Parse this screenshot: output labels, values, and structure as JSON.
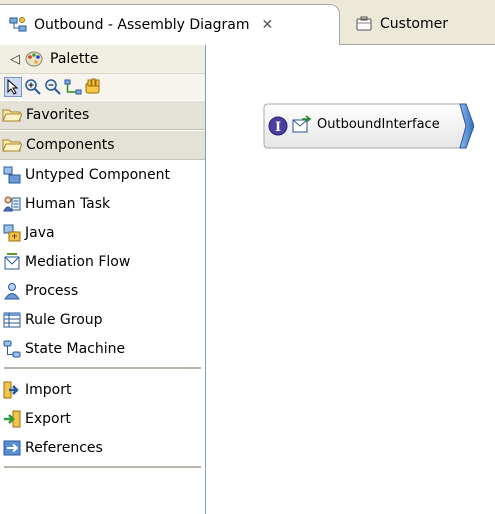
{
  "tabs": [
    {
      "label": "Outbound - Assembly Diagram",
      "icon": "assembly-diagram-icon",
      "active": true,
      "close": "✕"
    },
    {
      "label": "Customer",
      "icon": "business-object-icon",
      "active": false
    }
  ],
  "palette": {
    "title": "Palette",
    "tools": [
      "select-arrow-icon",
      "zoom-in-icon",
      "zoom-out-icon",
      "wire-icon",
      "hand-icon"
    ],
    "favorites_label": "Favorites",
    "components_label": "Components",
    "components": [
      {
        "label": "Untyped Component",
        "icon": "untyped-component-icon"
      },
      {
        "label": "Human Task",
        "icon": "human-task-icon"
      },
      {
        "label": "Java",
        "icon": "java-component-icon"
      },
      {
        "label": "Mediation Flow",
        "icon": "mediation-flow-icon"
      },
      {
        "label": "Process",
        "icon": "process-icon"
      },
      {
        "label": "Rule Group",
        "icon": "rule-group-icon"
      },
      {
        "label": "State Machine",
        "icon": "state-machine-icon"
      }
    ],
    "others": [
      {
        "label": "Import",
        "icon": "import-icon"
      },
      {
        "label": "Export",
        "icon": "export-icon"
      },
      {
        "label": "References",
        "icon": "references-icon"
      }
    ]
  },
  "canvas": {
    "interface_label": "OutboundInterface"
  },
  "colors": {
    "accent_blue": "#3a79c4",
    "palette_bg": "#ece9d8"
  }
}
